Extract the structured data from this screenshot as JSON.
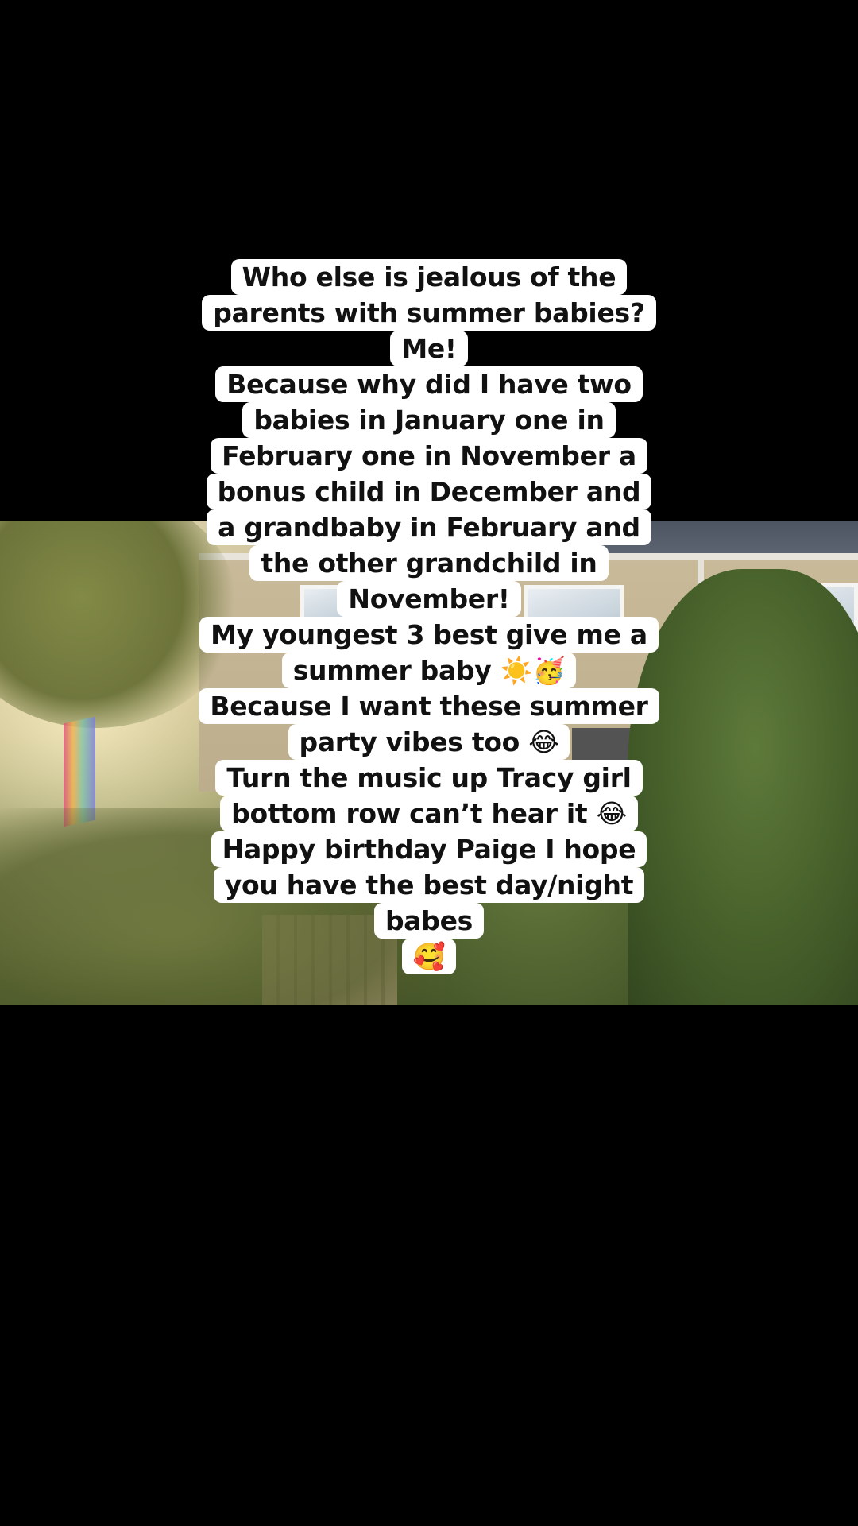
{
  "caption": {
    "lines": [
      "Who else is jealous of the",
      "parents with summer babies?",
      "Me!",
      "Because why did I have two",
      "babies in January one in",
      "February one in November a",
      "bonus child in December and",
      "a grandbaby in February and",
      "the other grandchild in",
      "November!",
      "My youngest 3 best give me a",
      "summer baby ☀️🥳",
      "Because I want these summer",
      "party vibes too 😂",
      "Turn the music up Tracy girl",
      "bottom row can’t hear it 😂",
      "Happy birthday Paige I hope",
      "you have the best day/night",
      "babes",
      "🥰"
    ]
  }
}
